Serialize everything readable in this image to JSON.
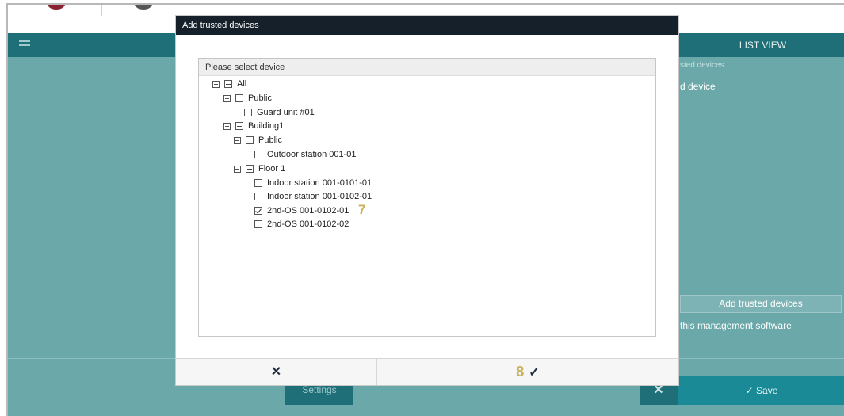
{
  "app": {
    "header_right_title": "LIST VIEW",
    "right_panel": {
      "trusted_header": "sted devices",
      "device_text": "d device",
      "add_button": "Add trusted devices",
      "mgmt_text": "this management software"
    },
    "footer": {
      "settings_label": "Settings",
      "close_symbol": "✕",
      "save_label": "✓ Save"
    }
  },
  "modal": {
    "title": "Add trusted devices",
    "tree_header": "Please select device",
    "tree": [
      {
        "label": "All",
        "state": "partial",
        "toggle": true
      },
      {
        "label": "Public",
        "state": "unchecked",
        "toggle": true
      },
      {
        "label": "Guard unit #01",
        "state": "unchecked",
        "toggle": false
      },
      {
        "label": "Building1",
        "state": "partial",
        "toggle": true
      },
      {
        "label": "Public",
        "state": "unchecked",
        "toggle": true
      },
      {
        "label": "Outdoor station 001-01",
        "state": "unchecked",
        "toggle": false
      },
      {
        "label": "Floor 1",
        "state": "partial",
        "toggle": true
      },
      {
        "label": "Indoor station 001-0101-01",
        "state": "unchecked",
        "toggle": false
      },
      {
        "label": "Indoor station 001-0102-01",
        "state": "unchecked",
        "toggle": false
      },
      {
        "label": "2nd-OS 001-0102-01",
        "state": "checked",
        "toggle": false
      },
      {
        "label": "2nd-OS 001-0102-02",
        "state": "unchecked",
        "toggle": false
      }
    ],
    "step_marker_1": "7",
    "step_marker_2": "8",
    "cancel_symbol": "✕",
    "ok_symbol": "✓"
  }
}
